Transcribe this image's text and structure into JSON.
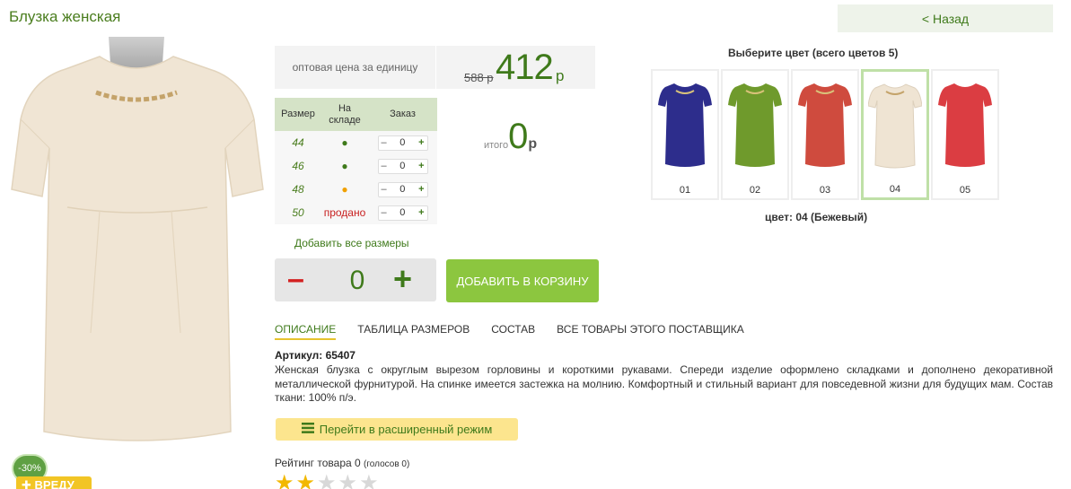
{
  "header": {
    "title": "Блузка женская",
    "back_label": "< Назад"
  },
  "photo": {
    "discount": "-30%",
    "tag": "✚ ВРЕДУ",
    "color": "#f0e5d4"
  },
  "price": {
    "label": "оптовая цена за единицу",
    "old": "588 р",
    "new": "412",
    "currency": "р"
  },
  "sizes": {
    "headers": [
      "Размер",
      "На складе",
      "Заказ"
    ],
    "rows": [
      {
        "size": "44",
        "stock": "●",
        "qty": "0"
      },
      {
        "size": "46",
        "stock": "●",
        "qty": "0"
      },
      {
        "size": "48",
        "stock": "●",
        "qty": "0"
      },
      {
        "size": "50",
        "stock": "продано",
        "qty": "0"
      }
    ]
  },
  "total": {
    "label": "итого",
    "value": "0",
    "currency": "р"
  },
  "add_all_sizes": "Добавить все размеры",
  "stepper": {
    "minus": "–",
    "qty": "0",
    "plus": "+"
  },
  "cart": {
    "label": "ДОБАВИТЬ В КОРЗИНУ"
  },
  "colors": {
    "title": "Выберите цвет (всего цветов 5)",
    "items": [
      {
        "label": "01",
        "color": "#2d2d8c"
      },
      {
        "label": "02",
        "color": "#6f9a2c"
      },
      {
        "label": "03",
        "color": "#cf4b3e"
      },
      {
        "label": "04",
        "color": "#efe4d3"
      },
      {
        "label": "05",
        "color": "#db3d42"
      }
    ],
    "current": "цвет: 04 (Бежевый)"
  },
  "tabs": [
    "ОПИСАНИЕ",
    "ТАБЛИЦА РАЗМЕРОВ",
    "СОСТАВ",
    "ВСЕ ТОВАРЫ ЭТОГО ПОСТАВЩИКА"
  ],
  "article": "Артикул: 65407",
  "description": "Женская блузка с округлым вырезом горловины и короткими рукавами. Спереди изделие оформлено складками и дополнено декоративной металлической фурнитурой. На спинке  имеется застежка на молнию. Комфортный и стильный вариант для повседевной жизни для будущих мам. Состав ткани: 100% п/э.",
  "advanced": {
    "label": "Перейти в расширенный режим"
  },
  "rating": {
    "label": "Рейтинг товара 0",
    "votes": "(голосов 0)",
    "stars_filled": 2,
    "stars_total": 5
  }
}
